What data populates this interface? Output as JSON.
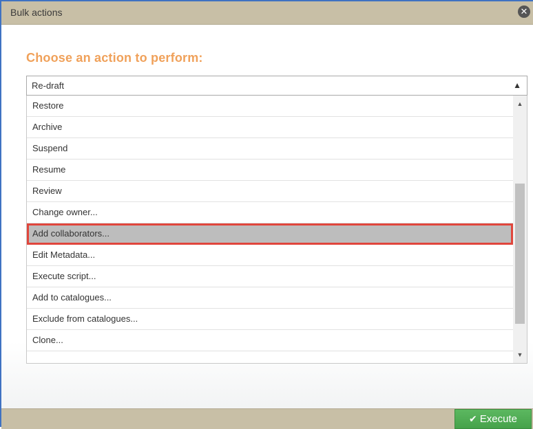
{
  "dialog": {
    "title": "Bulk actions",
    "close_icon": "close-circle-icon",
    "heading": "Choose an action to perform:"
  },
  "action_select": {
    "selected": "Re-draft",
    "arrow_icon": "triangle-up-icon",
    "options": [
      "Restore",
      "Archive",
      "Suspend",
      "Resume",
      "Review",
      "Change owner...",
      "Add collaborators...",
      "Edit Metadata...",
      "Execute script...",
      "Add to catalogues...",
      "Exclude from catalogues...",
      "Clone..."
    ],
    "highlighted_option": "Add collaborators..."
  },
  "footer": {
    "execute_label": "Execute",
    "execute_icon": "checkmark-icon"
  },
  "colors": {
    "titlebar_bg": "#c8bfa6",
    "heading": "#f0a15a",
    "highlight_border": "#e0463c",
    "highlight_bg": "#bdbdbd",
    "execute_bg": "#4fad54",
    "window_border": "#3f72c2"
  }
}
